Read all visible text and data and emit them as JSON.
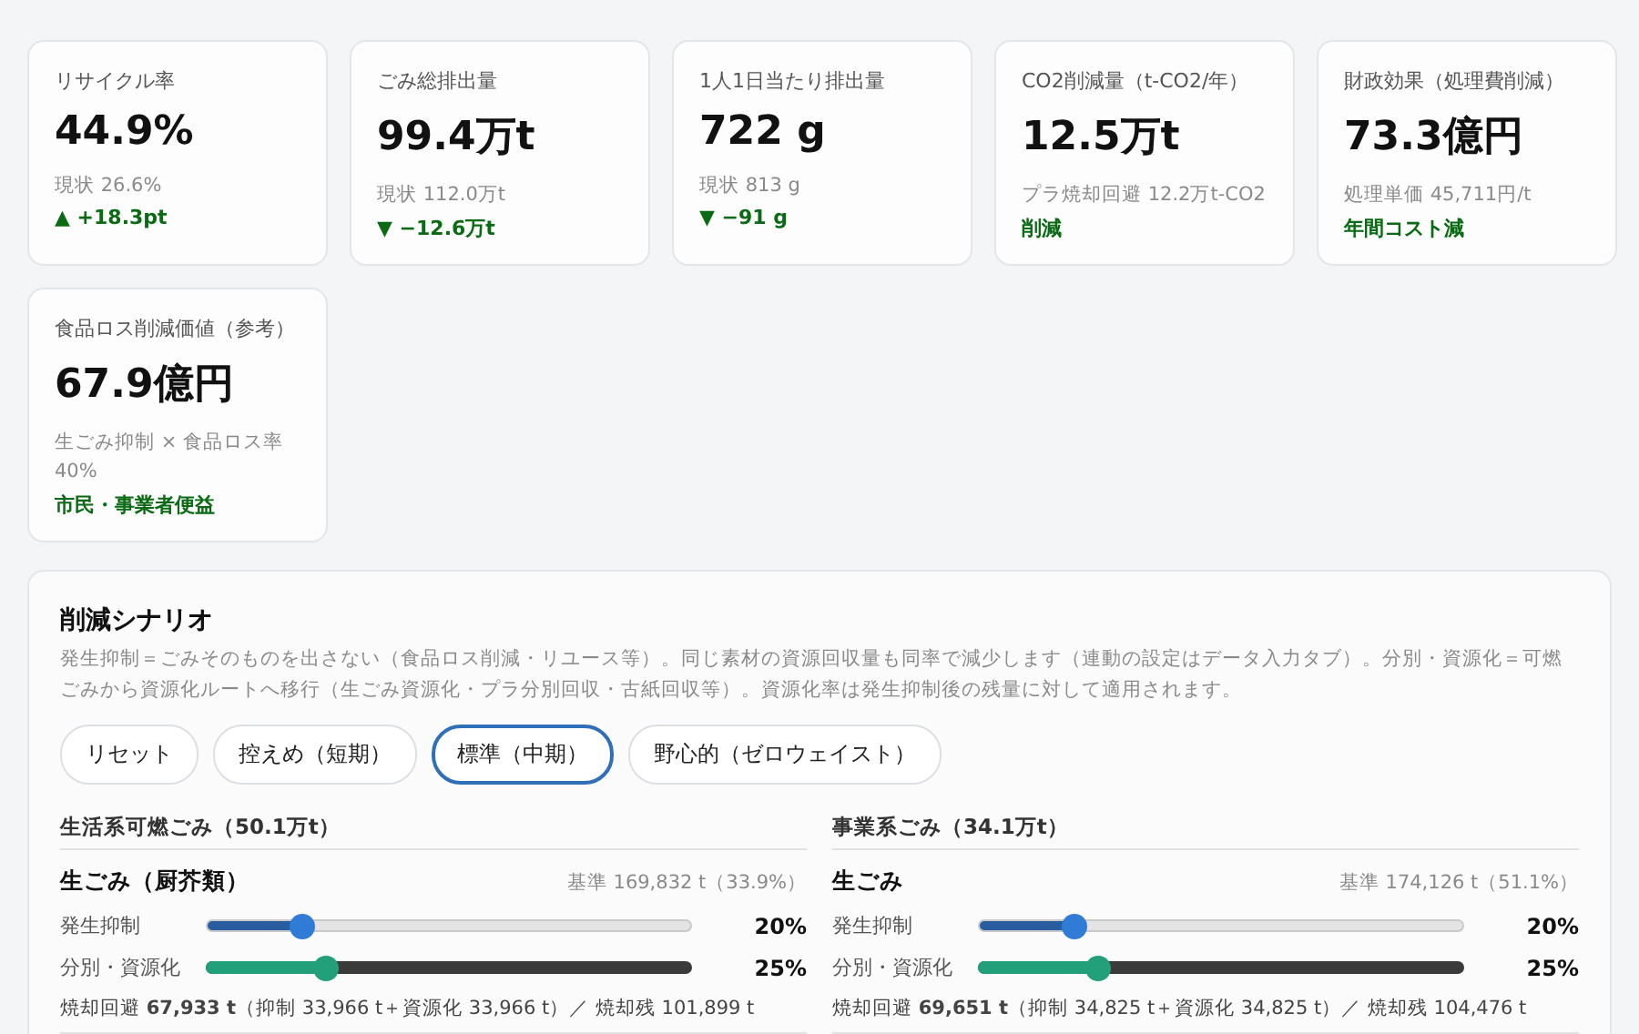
{
  "kpis": [
    {
      "label": "リサイクル率",
      "value": "44.9%",
      "baseline": "現状 26.6%",
      "delta": "▲ +18.3pt"
    },
    {
      "label": "ごみ総排出量",
      "value": "99.4万t",
      "baseline": "現状 112.0万t",
      "delta": "▼ −12.6万t"
    },
    {
      "label": "1人1日当たり排出量",
      "value": "722 g",
      "baseline": "現状 813 g",
      "delta": "▼ −91 g"
    },
    {
      "label": "CO2削減量（t-CO2/年）",
      "value": "12.5万t",
      "baseline": "プラ焼却回避 12.2万t-CO2",
      "delta": "削減"
    },
    {
      "label": "財政効果（処理費削減）",
      "value": "73.3億円",
      "baseline": "処理単価 45,711円/t",
      "delta": "年間コスト減"
    },
    {
      "label": "食品ロス削減価値（参考）",
      "value": "67.9億円",
      "baseline": "生ごみ抑制 × 食品ロス率 40%",
      "delta": "市民・事業者便益"
    }
  ],
  "scenario": {
    "title": "削減シナリオ",
    "description": "発生抑制＝ごみそのものを出さない（食品ロス削減・リユース等）。同じ素材の資源回収量も同率で減少します（連動の設定はデータ入力タブ）。分別・資源化＝可燃ごみから資源化ルートへ移行（生ごみ資源化・プラ分別回収・古紙回収等）。資源化率は発生抑制後の残量に対して適用されます。",
    "presets": [
      {
        "label": "リセット",
        "selected": false
      },
      {
        "label": "控えめ（短期）",
        "selected": false
      },
      {
        "label": "標準（中期）",
        "selected": true
      },
      {
        "label": "野心的（ゼロウェイスト）",
        "selected": false
      }
    ],
    "groups": [
      {
        "title": "生活系可燃ごみ（50.1万t）",
        "items": [
          {
            "name": "生ごみ（厨芥類）",
            "base": "基準 169,832 t（33.9%）",
            "sliders": [
              {
                "kind": "prevention",
                "label": "発生抑制",
                "level": 0.2,
                "reading": "20%"
              },
              {
                "kind": "recycling",
                "label": "分別・資源化",
                "level": 0.25,
                "reading": "25%"
              }
            ],
            "summary": "焼却回避 **67,933 t**（抑制 33,966 t＋資源化 33,966 t）／ 焼却残 101,899 t"
          }
        ]
      },
      {
        "title": "事業系ごみ（34.1万t）",
        "items": [
          {
            "name": "生ごみ",
            "base": "基準 174,126 t（51.1%）",
            "sliders": [
              {
                "kind": "prevention",
                "label": "発生抑制",
                "level": 0.2,
                "reading": "20%"
              },
              {
                "kind": "recycling",
                "label": "分別・資源化",
                "level": 0.25,
                "reading": "25%"
              }
            ],
            "summary": "焼却回避 **69,651 t**（抑制 34,825 t＋資源化 34,825 t）／ 焼却残 104,476 t"
          }
        ]
      }
    ]
  }
}
